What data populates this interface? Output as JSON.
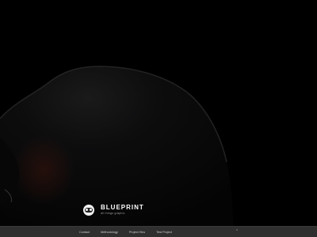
{
  "brand": {
    "title": "BLUEPRINT",
    "subtitle": "all things graphic",
    "logo_icon": "glasses-logo-icon"
  },
  "nav": {
    "items": [
      {
        "label": "Contact"
      },
      {
        "label": "Methodology"
      },
      {
        "label": "Project Hivs"
      },
      {
        "label": "Test Project"
      }
    ],
    "chevron_icon": "chevron-up-icon"
  },
  "colors": {
    "background": "#000000",
    "navbar": "#2f2f2f",
    "brand_text": "#ffffff",
    "nav_text": "#cfcfcf"
  }
}
